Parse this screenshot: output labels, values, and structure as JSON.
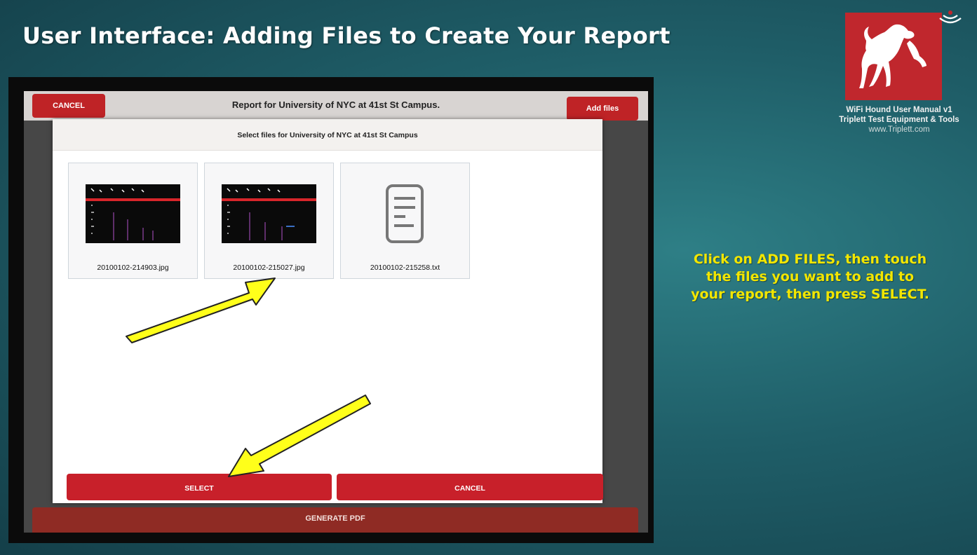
{
  "slide": {
    "title": "User Interface: Adding Files to Create Your Report",
    "credit_line1": "WiFi Hound User Manual v1",
    "credit_line2": "Triplett Test Equipment & Tools",
    "credit_url": "www.Triplett.com",
    "instructions": "Click on ADD FILES, then touch  the files you want to add to your report, then press SELECT.",
    "logo_icon": "dog-logo-icon",
    "colors": {
      "instruction_text": "#f2e600",
      "logo_bg": "#c0272d",
      "button_red": "#c8202a"
    }
  },
  "app": {
    "cancel_label": "CANCEL",
    "report_title": "Report for University of NYC at 41st St Campus.",
    "add_files_label": "Add files",
    "generate_pdf_label": "GENERATE PDF"
  },
  "dialog": {
    "title": "Select files for University of NYC at 41st St Campus",
    "files": [
      {
        "name": "20100102-214903.jpg",
        "icon": "image-thumbnail"
      },
      {
        "name": "20100102-215027.jpg",
        "icon": "image-thumbnail"
      },
      {
        "name": "20100102-215258.txt",
        "icon": "text-file-icon"
      }
    ],
    "select_label": "SELECT",
    "cancel_label": "CANCEL"
  }
}
